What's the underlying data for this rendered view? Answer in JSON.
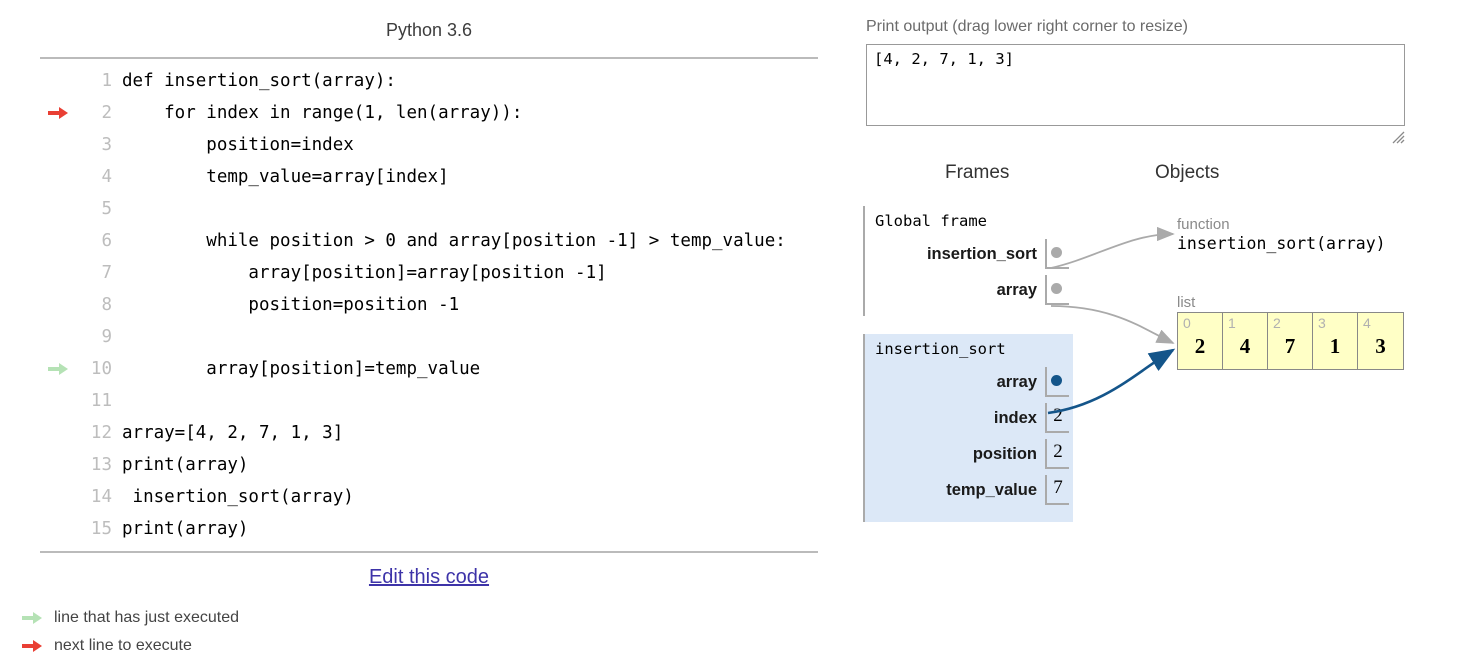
{
  "app": {
    "python_version": "Python 3.6",
    "edit_link": "Edit this code"
  },
  "code": {
    "lines": [
      {
        "num": "1",
        "text": "def insertion_sort(array):",
        "marker": "none"
      },
      {
        "num": "2",
        "text": "    for index in range(1, len(array)):",
        "marker": "next"
      },
      {
        "num": "3",
        "text": "        position=index",
        "marker": "none"
      },
      {
        "num": "4",
        "text": "        temp_value=array[index]",
        "marker": "none"
      },
      {
        "num": "5",
        "text": "",
        "marker": "none"
      },
      {
        "num": "6",
        "text": "        while position > 0 and array[position -1] > temp_value:",
        "marker": "none"
      },
      {
        "num": "7",
        "text": "            array[position]=array[position -1]",
        "marker": "none"
      },
      {
        "num": "8",
        "text": "            position=position -1",
        "marker": "none"
      },
      {
        "num": "9",
        "text": "",
        "marker": "none"
      },
      {
        "num": "10",
        "text": "        array[position]=temp_value",
        "marker": "executed"
      },
      {
        "num": "11",
        "text": "",
        "marker": "none"
      },
      {
        "num": "12",
        "text": "array=[4, 2, 7, 1, 3]",
        "marker": "none"
      },
      {
        "num": "13",
        "text": "print(array)",
        "marker": "none"
      },
      {
        "num": "14",
        "text": " insertion_sort(array)",
        "marker": "none"
      },
      {
        "num": "15",
        "text": "print(array)",
        "marker": "none"
      }
    ]
  },
  "legend": {
    "executed_label": "line that has just executed",
    "next_label": "next line to execute",
    "executed_color": "#b5e2b5",
    "next_color": "#e93f34"
  },
  "print_output": {
    "label": "Print output (drag lower right corner to resize)",
    "value": "[4, 2, 7, 1, 3]"
  },
  "viz": {
    "frames_heading": "Frames",
    "objects_heading": "Objects",
    "frames": [
      {
        "title": "Global frame",
        "kind": "global",
        "vars": [
          {
            "name": "insertion_sort",
            "value": "",
            "is_pointer": true,
            "dot": "gray"
          },
          {
            "name": "array",
            "value": "",
            "is_pointer": true,
            "dot": "gray"
          }
        ]
      },
      {
        "title": "insertion_sort",
        "kind": "local",
        "vars": [
          {
            "name": "array",
            "value": "",
            "is_pointer": true,
            "dot": "blue"
          },
          {
            "name": "index",
            "value": "2",
            "is_pointer": false,
            "dot": ""
          },
          {
            "name": "position",
            "value": "2",
            "is_pointer": false,
            "dot": ""
          },
          {
            "name": "temp_value",
            "value": "7",
            "is_pointer": false,
            "dot": ""
          }
        ]
      }
    ],
    "objects": {
      "function": {
        "type_label": "function",
        "signature": "insertion_sort(array)"
      },
      "list": {
        "type_label": "list",
        "indices": [
          "0",
          "1",
          "2",
          "3",
          "4"
        ],
        "values": [
          "2",
          "4",
          "7",
          "1",
          "3"
        ]
      }
    }
  },
  "colors": {
    "list_cell_bg": "#ffffc6",
    "local_frame_bg": "#dce8f7",
    "pointer_blue": "#14558a",
    "pointer_gray": "#aaaaaa",
    "link_blue": "#3d33a8"
  }
}
